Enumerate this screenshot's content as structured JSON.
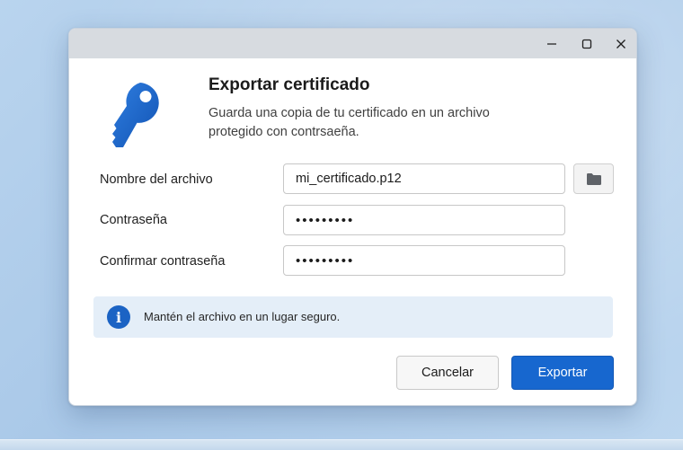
{
  "window": {
    "controls": {
      "minimize_icon": "minimize-icon",
      "maximize_icon": "maximize-icon",
      "close_icon": "close-icon"
    }
  },
  "header": {
    "icon": "key-icon",
    "title": "Exportar certificado",
    "subtitle": "Guarda una copia de tu certificado en un archivo protegido con contrsaeña."
  },
  "form": {
    "filename": {
      "label": "Nombre del archivo",
      "value": "mi_certificado.p12",
      "browse_icon": "folder-icon"
    },
    "password": {
      "label": "Contraseña",
      "value": "•••••••••"
    },
    "confirm_password": {
      "label": "Confirmar contraseña",
      "value": "•••••••••"
    }
  },
  "info": {
    "icon": "info-icon",
    "text": "Mantén el archivo en un lugar seguro."
  },
  "actions": {
    "cancel_label": "Cancelar",
    "export_label": "Exportar"
  },
  "colors": {
    "accent": "#1767cf",
    "info_background": "#e4eef8",
    "icon_blue": "#1b63c4"
  }
}
